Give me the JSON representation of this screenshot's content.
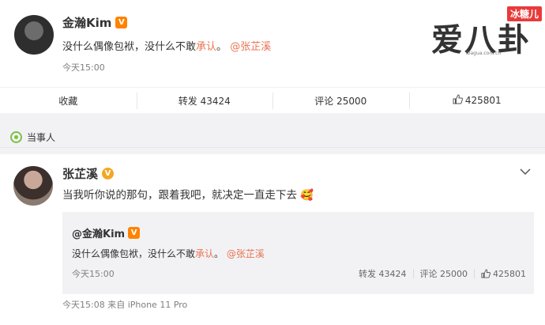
{
  "post": {
    "author": "金瀚Kim",
    "badge": "V",
    "text_prefix": "没什么偶像包袱，没什么不敢",
    "text_highlight": "承认",
    "text_mid": "。",
    "mention": "@张芷溪",
    "time": "今天15:00"
  },
  "actions": {
    "favorite": "收藏",
    "repost": "转发 43424",
    "comment": "评论 25000",
    "like": "425801"
  },
  "section": {
    "label": "当事人"
  },
  "reply": {
    "author": "张芷溪",
    "badge": "V",
    "text": "当我听你说的那句，跟着我吧，就决定一直走下去",
    "emoji": "🥰",
    "footer": "今天15:08  来自 iPhone 11 Pro"
  },
  "quoted": {
    "author": "@金瀚Kim",
    "badge": "V",
    "text_prefix": "没什么偶像包袱，没什么不敢",
    "text_highlight": "承认",
    "text_mid": "。",
    "mention": "@张芷溪",
    "time": "今天15:00",
    "repost": "转发 43424",
    "comment": "评论 25000",
    "like": "425801"
  },
  "watermark": {
    "main": "爱八卦",
    "tag": "冰糖儿",
    "url": "ibagua.com.cn"
  },
  "colors": {
    "accent": "#eb7350",
    "badge": "#ff8200"
  }
}
